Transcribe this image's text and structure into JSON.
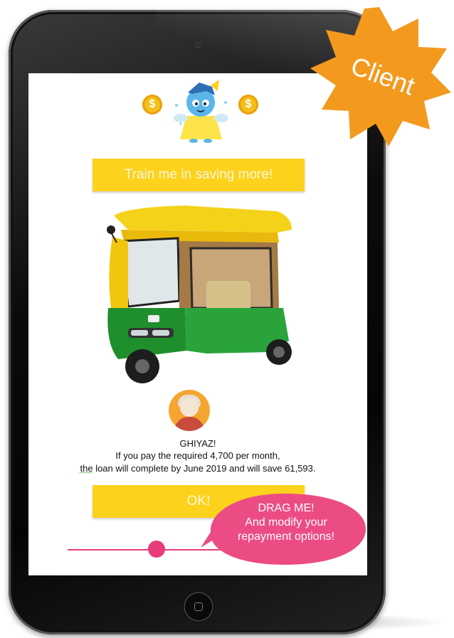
{
  "badge": {
    "label": "Client",
    "color": "#f39a1e"
  },
  "mascot": {
    "coin_symbol": "$"
  },
  "train_button": {
    "label": "Train me in saving more!"
  },
  "message": {
    "name": "GHIYAZ!",
    "line1": "If you pay the required 4,700 per month,",
    "line2_underlined": "the",
    "line2_rest": " loan will complete by June 2019  and will save 61,593."
  },
  "ok_button": {
    "label": "OK!"
  },
  "tooltip": {
    "line1": "DRAG ME!",
    "line2": "And modify your",
    "line3": "repayment options!"
  },
  "colors": {
    "accent_yellow": "#fcd21d",
    "slider_pink": "#ea3c7d"
  }
}
